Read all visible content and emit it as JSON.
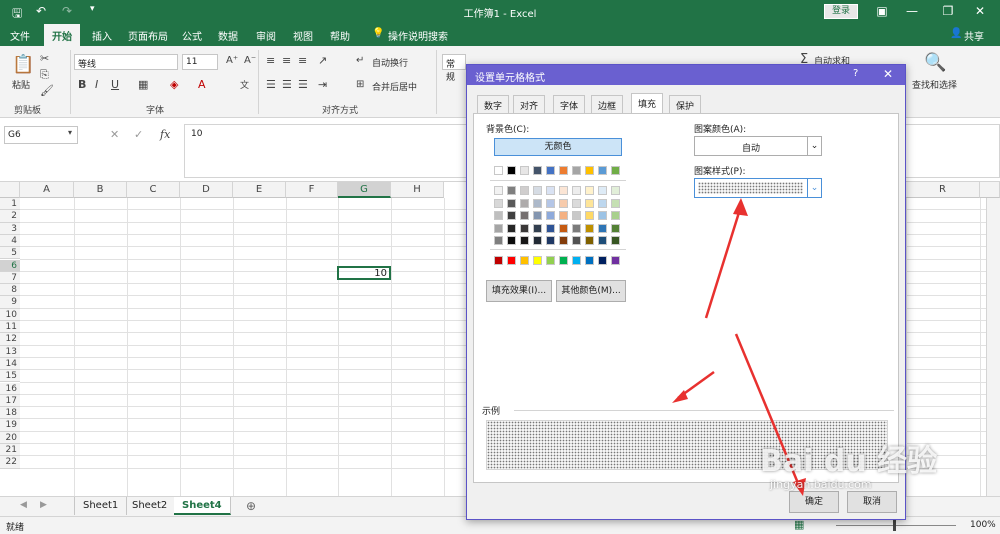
{
  "window": {
    "title": "工作簿1 - Excel",
    "login_label": "登录",
    "share_label": "共享"
  },
  "ribbon_tabs": [
    "文件",
    "开始",
    "插入",
    "页面布局",
    "公式",
    "数据",
    "审阅",
    "视图",
    "帮助",
    "操作说明搜索"
  ],
  "ribbon": {
    "paste_label": "粘贴",
    "clipboard_group": "剪贴板",
    "font_name": "等线",
    "font_size": "11",
    "font_group": "字体",
    "wrap_text": "自动换行",
    "merge_center": "合并后居中",
    "alignment_group": "对齐方式",
    "number_format": "常规",
    "autosum": "自动求和",
    "find_select": "查找和选择"
  },
  "formula_bar": {
    "name_box": "G6",
    "fx_label": "fx",
    "value": "10"
  },
  "grid": {
    "columns": [
      "A",
      "B",
      "C",
      "D",
      "E",
      "F",
      "G",
      "H",
      "R"
    ],
    "rows": [
      "1",
      "2",
      "3",
      "4",
      "5",
      "6",
      "7",
      "8",
      "9",
      "10",
      "11",
      "12",
      "13",
      "14",
      "15",
      "16",
      "17",
      "18",
      "19",
      "20",
      "21",
      "22"
    ],
    "active_cell_value": "10"
  },
  "sheets": [
    "Sheet1",
    "Sheet2",
    "Sheet4"
  ],
  "active_sheet": "Sheet4",
  "status": {
    "mode": "就绪",
    "zoom": "100%"
  },
  "dialog": {
    "title": "设置单元格格式",
    "help": "?",
    "tabs": [
      "数字",
      "对齐",
      "字体",
      "边框",
      "填充",
      "保护"
    ],
    "active_tab": "填充",
    "bg_color_label": "背景色(C):",
    "no_color": "无颜色",
    "fill_effects": "填充效果(I)...",
    "more_colors": "其他颜色(M)...",
    "pattern_color_label": "图案颜色(A):",
    "pattern_color_value": "自动",
    "pattern_style_label": "图案样式(P):",
    "sample_label": "示例",
    "ok": "确定",
    "cancel": "取消"
  },
  "colors": {
    "accent": "#217346",
    "dialog_title": "#6a60d0",
    "arrow": "#e8312f",
    "standard_colors": [
      "#c00000",
      "#ff0000",
      "#ffc000",
      "#ffff00",
      "#92d050",
      "#00b050",
      "#00b0f0",
      "#0070c0",
      "#002060",
      "#7030a0"
    ],
    "theme_top": [
      "#ffffff",
      "#000000",
      "#e7e6e6",
      "#44546a",
      "#4472c4",
      "#ed7d31",
      "#a5a5a5",
      "#ffc000",
      "#5b9bd5",
      "#70ad47"
    ],
    "theme_shades": [
      [
        "#f2f2f2",
        "#7f7f7f",
        "#d0cece",
        "#d6dce4",
        "#d9e2f3",
        "#fbe5d5",
        "#ededed",
        "#fff2cc",
        "#deebf6",
        "#e2efd9"
      ],
      [
        "#d8d8d8",
        "#595959",
        "#aeabab",
        "#adb9ca",
        "#b4c6e7",
        "#f7cbac",
        "#dbdbdb",
        "#fee599",
        "#bdd7ee",
        "#c5e0b3"
      ],
      [
        "#bfbfbf",
        "#3f3f3f",
        "#757070",
        "#8496b0",
        "#8eaadb",
        "#f4b183",
        "#c9c9c9",
        "#ffd965",
        "#9cc3e5",
        "#a8d08d"
      ],
      [
        "#a5a5a5",
        "#262626",
        "#3a3838",
        "#323f4f",
        "#2f5496",
        "#c55a11",
        "#7b7b7b",
        "#bf9000",
        "#2e75b5",
        "#538135"
      ],
      [
        "#7f7f7f",
        "#0c0c0c",
        "#171616",
        "#222a35",
        "#1f3864",
        "#833c0b",
        "#525252",
        "#7f6000",
        "#1e4e79",
        "#375623"
      ]
    ]
  },
  "icons": [
    "save-icon",
    "undo-icon",
    "redo-icon",
    "lightbulb-icon",
    "user-icon",
    "paste-icon",
    "cut-icon",
    "copy-icon",
    "format-painter-icon",
    "bold-icon",
    "italic-icon",
    "underline-icon",
    "border-icon",
    "fill-color-icon",
    "font-color-icon",
    "align-icon",
    "sigma-icon",
    "search-icon",
    "cancel-x-icon",
    "check-icon",
    "close-icon",
    "chevron-down-icon",
    "add-sheet-icon"
  ],
  "watermark": {
    "brand": "Bai du 经验",
    "url": "jingyan.baidu.com"
  }
}
